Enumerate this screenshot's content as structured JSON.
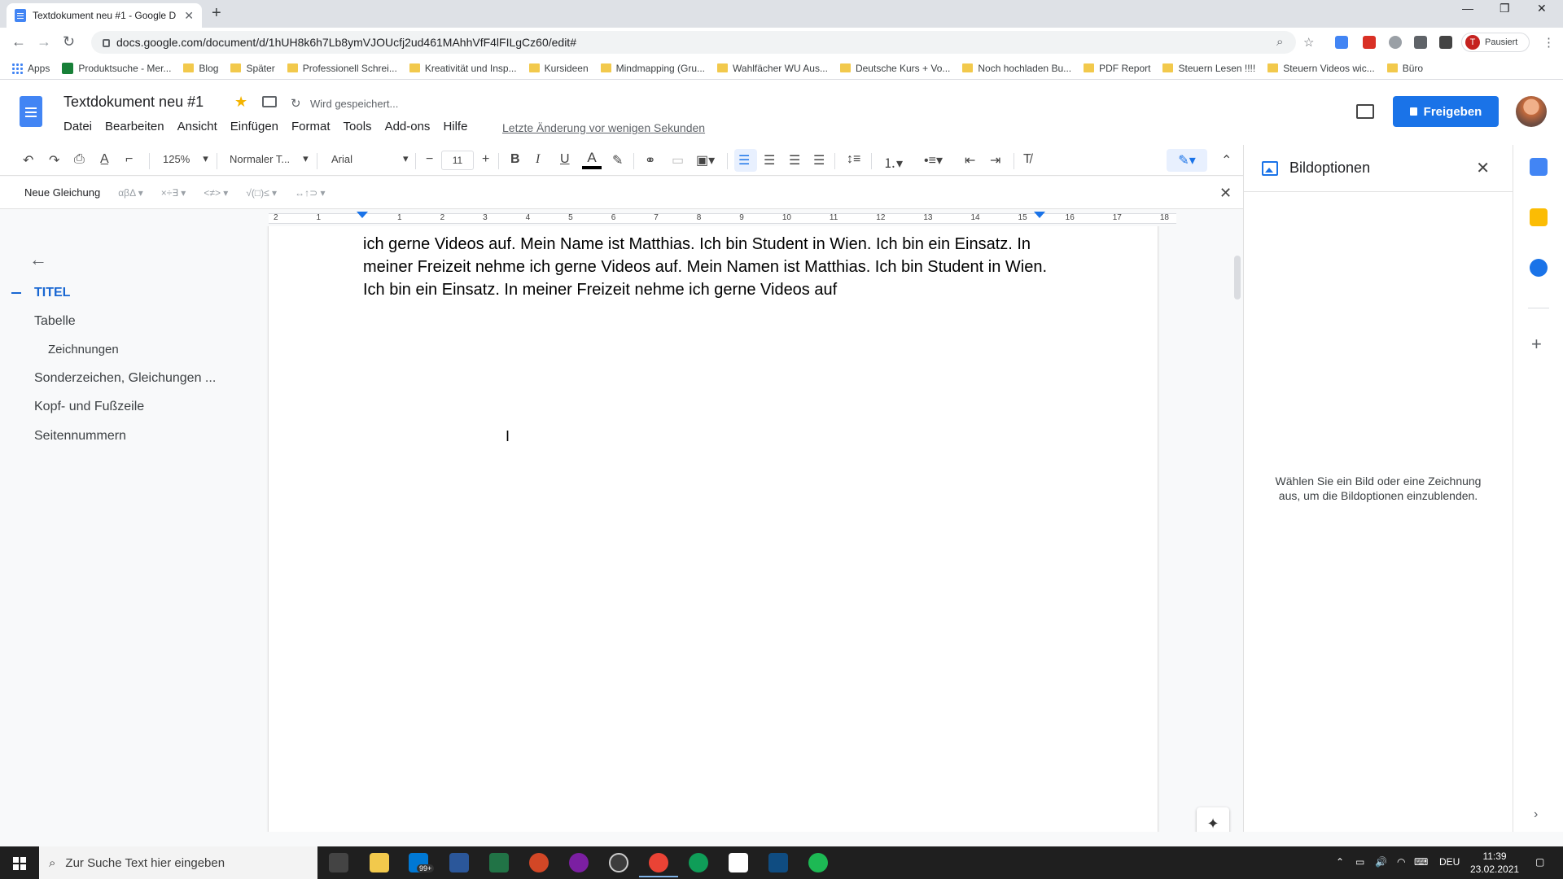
{
  "browser": {
    "tab_title": "Textdokument neu #1 - Google D",
    "url": "docs.google.com/document/d/1hUH8k6h7Lb8ymVJOUcfj2ud461MAhhVfF4lFILgCz60/edit#",
    "profile_label": "Pausiert",
    "profile_initial": "T",
    "extension_badge": "0"
  },
  "bookmarks": [
    "Apps",
    "Produktsuche - Mer...",
    "Blog",
    "Später",
    "Professionell Schrei...",
    "Kreativität und Insp...",
    "Kursideen",
    "Mindmapping (Gru...",
    "Wahlfächer WU Aus...",
    "Deutsche Kurs + Vo...",
    "Noch hochladen Bu...",
    "PDF Report",
    "Steuern Lesen !!!!",
    "Steuern Videos wic...",
    "Büro"
  ],
  "docs": {
    "title": "Textdokument neu #1",
    "save_status": "Wird gespeichert...",
    "menu": [
      "Datei",
      "Bearbeiten",
      "Ansicht",
      "Einfügen",
      "Format",
      "Tools",
      "Add-ons",
      "Hilfe"
    ],
    "last_edit": "Letzte Änderung vor wenigen Sekunden",
    "share_label": "Freigeben"
  },
  "toolbar": {
    "zoom": "125%",
    "style": "Normaler T...",
    "font": "Arial",
    "font_size": "11"
  },
  "equation": {
    "new_label": "Neue Gleichung",
    "groups": [
      "αβΔ ▾",
      "×÷∃ ▾",
      "<≠> ▾",
      "√(□)≤ ▾",
      "↔↑⊃ ▾"
    ]
  },
  "ruler": {
    "ticks": [
      "2",
      "1",
      "",
      "1",
      "2",
      "3",
      "4",
      "5",
      "6",
      "7",
      "8",
      "9",
      "10",
      "11",
      "12",
      "13",
      "14",
      "15",
      "16",
      "17",
      "18"
    ]
  },
  "outline": {
    "items": [
      {
        "label": "TITEL",
        "level": 1,
        "active": true
      },
      {
        "label": "Tabelle",
        "level": 1
      },
      {
        "label": "Zeichnungen",
        "level": 2
      },
      {
        "label": "Sonderzeichen, Gleichungen ...",
        "level": 1
      },
      {
        "label": "Kopf- und Fußzeile",
        "level": 1
      },
      {
        "label": "Seitennummern",
        "level": 1
      }
    ]
  },
  "page": {
    "paragraph": "Mein Name ist Matthias. Ich bin Student in Wien. Ich bin ein Einsatz. In meiner Freizeit nehme ich gerne Videos auf. Mein Name ist Matthias. Ich bin Student in Wien. Ich bin ein Einsatz. In meiner Freizeit nehme ich gerne Videos auf. Mein Namen ist Matthias. Ich bin Student in Wien. Ich bin ein Einsatz. In meiner Freizeit nehme ich gerne Videos auf"
  },
  "image_panel": {
    "title": "Bildoptionen",
    "message": "Wählen Sie ein Bild oder eine Zeichnung aus, um die Bildoptionen einzublenden."
  },
  "taskbar": {
    "search_placeholder": "Zur Suche Text hier eingeben",
    "mail_badge": "99+",
    "language": "DEU",
    "time": "11:39",
    "date": "23.02.2021"
  },
  "colors": {
    "accent": "#1a73e8",
    "outline_active": "#1967d2",
    "star": "#f4b400"
  }
}
